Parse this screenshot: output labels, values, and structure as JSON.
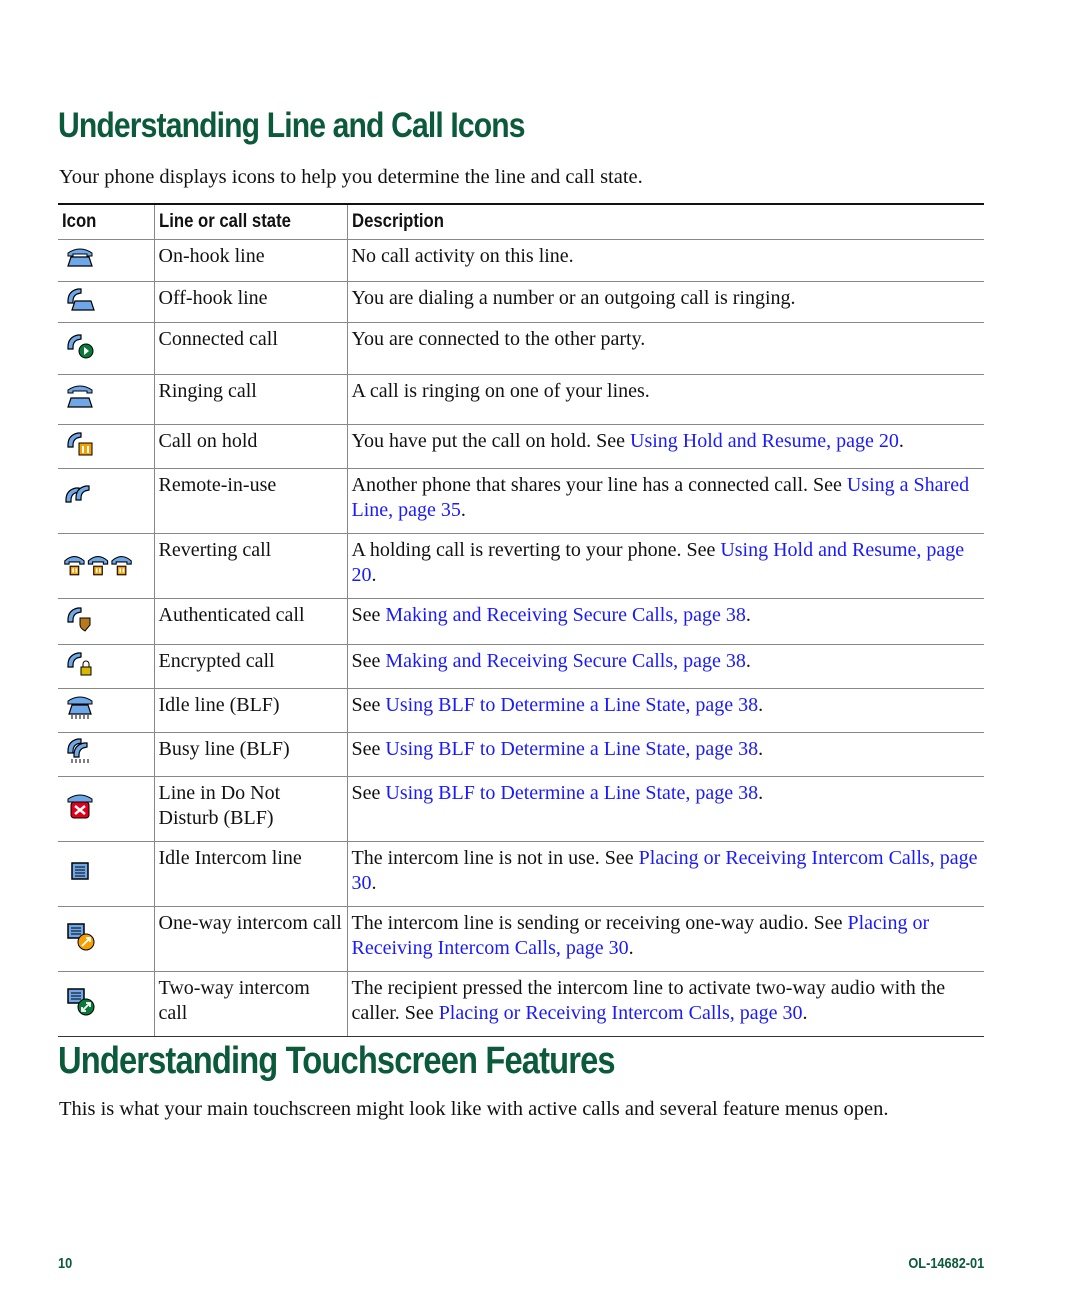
{
  "section1": {
    "title": "Understanding Line and Call Icons",
    "intro": "Your phone displays icons to help you determine the line and call state."
  },
  "table": {
    "headers": [
      "Icon",
      "Line or call state",
      "Description"
    ],
    "rows": [
      {
        "icon": "on-hook-phone-icon",
        "state": "On-hook line",
        "desc": "No call activity on this line.",
        "link": "",
        "after": ""
      },
      {
        "icon": "off-hook-phone-icon",
        "state": "Off-hook line",
        "desc": "You are dialing a number or an outgoing call is ringing.",
        "link": "",
        "after": ""
      },
      {
        "icon": "connected-call-icon",
        "state": "Connected call",
        "desc": "You are connected to the other party.",
        "link": "",
        "after": ""
      },
      {
        "icon": "ringing-call-icon",
        "state": "Ringing call",
        "desc": "A call is ringing on one of your lines.",
        "link": "",
        "after": ""
      },
      {
        "icon": "call-on-hold-icon",
        "state": "Call on hold",
        "desc": "You have put the call on hold. See ",
        "link": "Using Hold and Resume, page 20",
        "after": "."
      },
      {
        "icon": "remote-in-use-icon",
        "state": "Remote-in-use",
        "desc": "Another phone that shares your line has a connected call. See ",
        "link": "Using a Shared Line, page 35",
        "after": "."
      },
      {
        "icon": "reverting-call-icon",
        "state": "Reverting call",
        "desc": "A holding call is reverting to your phone. See ",
        "link": "Using Hold and Resume, page 20",
        "after": "."
      },
      {
        "icon": "authenticated-call-icon",
        "state": "Authenticated call",
        "desc": "See ",
        "link": "Making and Receiving Secure Calls, page 38",
        "after": "."
      },
      {
        "icon": "encrypted-call-icon",
        "state": "Encrypted call",
        "desc": "See ",
        "link": "Making and Receiving Secure Calls, page 38",
        "after": "."
      },
      {
        "icon": "idle-line-blf-icon",
        "state": "Idle line (BLF)",
        "desc": "See ",
        "link": "Using BLF to Determine a Line State, page 38",
        "after": "."
      },
      {
        "icon": "busy-line-blf-icon",
        "state": "Busy line (BLF)",
        "desc": "See ",
        "link": "Using BLF to Determine a Line State, page 38",
        "after": "."
      },
      {
        "icon": "do-not-disturb-blf-icon",
        "state": "Line in Do Not Disturb (BLF)",
        "desc": "See ",
        "link": "Using BLF to Determine a Line State, page 38",
        "after": "."
      },
      {
        "icon": "idle-intercom-icon",
        "state": "Idle Intercom line",
        "desc": "The intercom line is not in use. See ",
        "link": "Placing or Receiving Intercom Calls, page 30",
        "after": "."
      },
      {
        "icon": "one-way-intercom-icon",
        "state": "One-way intercom call",
        "desc": "The intercom line is sending or receiving one-way audio. See ",
        "link": "Placing or Receiving Intercom Calls, page 30",
        "after": "."
      },
      {
        "icon": "two-way-intercom-icon",
        "state": "Two-way intercom call",
        "desc": "The recipient pressed the intercom line to activate two-way audio with the caller. See ",
        "link": "Placing or Receiving Intercom Calls, page 30",
        "after": "."
      }
    ]
  },
  "section2": {
    "title": "Understanding Touchscreen Features",
    "intro": "This is what your main touchscreen might look like with active calls and several feature menus open."
  },
  "footer": {
    "page_number": "10",
    "doc_number": "OL-14682-01"
  },
  "colors": {
    "heading": "#0b5a3b",
    "link": "#1a1aff"
  }
}
